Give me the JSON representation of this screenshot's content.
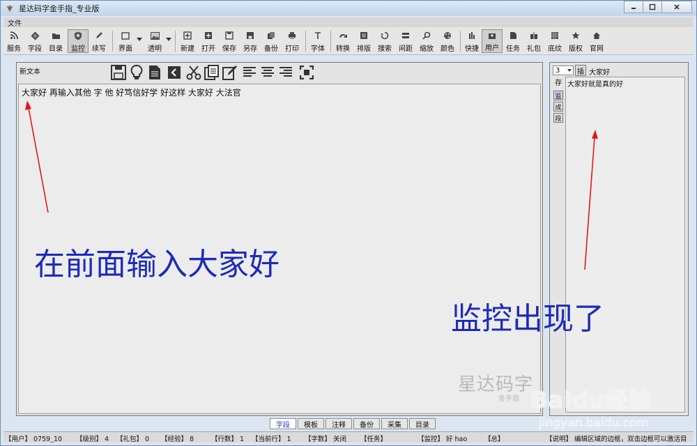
{
  "window": {
    "title": "星达码字金手指_专业版",
    "controls": [
      "minimize-icon",
      "maximize-icon",
      "close-icon"
    ]
  },
  "menubar": {
    "items": [
      "文件"
    ]
  },
  "toolbar": {
    "items": [
      {
        "id": "service",
        "label": "服务",
        "icon": "rss-icon"
      },
      {
        "id": "segment",
        "label": "字段",
        "icon": "diamond-icon"
      },
      {
        "id": "catalog",
        "label": "目录",
        "icon": "folder-icon"
      },
      {
        "id": "monitor",
        "label": "监控",
        "icon": "shield-icon",
        "pressed": true
      },
      {
        "id": "continue",
        "label": "续写",
        "icon": "pen-icon"
      },
      {
        "id": "interface",
        "label": "界面",
        "icon": "window-icon",
        "dropdown": true
      },
      {
        "id": "transparent",
        "label": "透明",
        "icon": "image-icon",
        "dropdown": true
      },
      {
        "id": "new",
        "label": "新建",
        "icon": "new-file-icon"
      },
      {
        "id": "open",
        "label": "打开",
        "icon": "open-icon"
      },
      {
        "id": "save",
        "label": "保存",
        "icon": "save-icon"
      },
      {
        "id": "saveas",
        "label": "另存",
        "icon": "save-as-icon"
      },
      {
        "id": "backup",
        "label": "备份",
        "icon": "backup-icon"
      },
      {
        "id": "print",
        "label": "打印",
        "icon": "print-icon"
      },
      {
        "id": "font",
        "label": "字体",
        "icon": "font-icon"
      },
      {
        "id": "convert",
        "label": "转换",
        "icon": "convert-icon"
      },
      {
        "id": "layout",
        "label": "排版",
        "icon": "layout-icon"
      },
      {
        "id": "search",
        "label": "搜索",
        "icon": "search-icon"
      },
      {
        "id": "spacing",
        "label": "间距",
        "icon": "spacing-icon"
      },
      {
        "id": "zoom",
        "label": "缩放",
        "icon": "zoom-icon"
      },
      {
        "id": "color",
        "label": "颜色",
        "icon": "palette-icon"
      },
      {
        "id": "shortcut",
        "label": "快捷",
        "icon": "lightning-icon"
      },
      {
        "id": "user",
        "label": "用户",
        "icon": "user-icon",
        "pressed": true
      },
      {
        "id": "task",
        "label": "任务",
        "icon": "task-icon"
      },
      {
        "id": "gift",
        "label": "礼包",
        "icon": "gift-icon"
      },
      {
        "id": "texture",
        "label": "底纹",
        "icon": "texture-icon"
      },
      {
        "id": "copyright",
        "label": "版权",
        "icon": "star-icon"
      },
      {
        "id": "website",
        "label": "官网",
        "icon": "home-icon"
      }
    ]
  },
  "editor": {
    "doc_title": "新文本",
    "tools": [
      "save-icon",
      "bulb-icon",
      "document-icon",
      "back-arrow-icon",
      "scissors-icon",
      "copy-icon",
      "edit-icon",
      "align-left-icon",
      "align-center-icon",
      "align-right-icon",
      "fullscreen-icon"
    ],
    "content": "大家好  再输入其他  字  他  好笃信好学  好这样  大家好  大法官",
    "annotation": "在前面输入大家好",
    "logo_big": "星达码字",
    "logo_small": "金手指"
  },
  "monitor_panel": {
    "select_value": "3",
    "insert_label": "插",
    "input_value": "大家好",
    "side_label": "存",
    "side_buttons": [
      "监",
      "成",
      "段"
    ],
    "result_line": "大家好就是真的好",
    "annotation": "监控出现了"
  },
  "tabs": [
    {
      "label": "字段",
      "active": true
    },
    {
      "label": "模板"
    },
    {
      "label": "注释"
    },
    {
      "label": "备份"
    },
    {
      "label": "采集"
    },
    {
      "label": "目录"
    }
  ],
  "statusbar": {
    "items": [
      "【用户】 0759_10",
      "【级别】 4",
      "【礼包】 0",
      "【经验】 8",
      "【行数】 1",
      "【当前行】 1",
      "【字数】 关闭",
      "【任务】",
      "【监控】 好 hao",
      "【总】",
      "【说明】 编辑区域的边框，双击边框可以激活目"
    ]
  },
  "watermark": {
    "brand": "Baidu经验",
    "url": "jingyan.baidu.com"
  },
  "colors": {
    "annotation": "#1c2bb7",
    "arrow": "#e01818",
    "active_tab": "#1d3ac0"
  }
}
